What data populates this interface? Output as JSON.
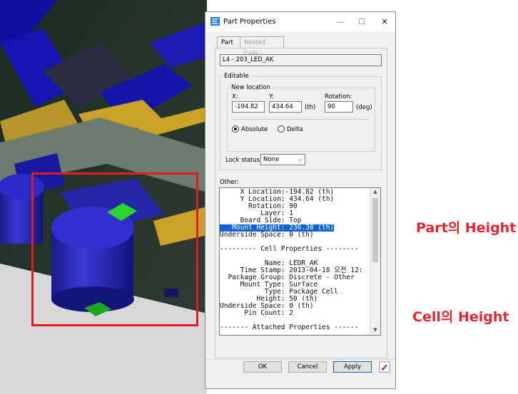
{
  "annotations": {
    "part_height_label": "Part의 Height",
    "cell_height_label": "Cell의 Height"
  },
  "dialog": {
    "title": "Part Properties",
    "title_icon": "app-icon",
    "controls": {
      "minimize": "—",
      "maximize": "☐",
      "close": "✕"
    },
    "tabs": [
      {
        "label": "Part",
        "active": true
      },
      {
        "label": "Nested Cells",
        "active": false
      }
    ],
    "part_name": "L4 - 203_LED_AK",
    "editable": {
      "group_label": "Editable",
      "new_location": {
        "group_label": "New location",
        "x_label": "X:",
        "x_value": "-194.82",
        "y_label": "Y:",
        "y_value": "434.64",
        "unit_th": "(th)",
        "rotation_label": "Rotation:",
        "rotation_value": "90",
        "unit_deg": "(deg)",
        "absolute_label": "Absolute",
        "delta_label": "Delta",
        "selected_mode": "Absolute"
      },
      "lock_status_label": "Lock status:",
      "lock_status_value": "None"
    },
    "other": {
      "label": "Other:",
      "lines": [
        "     X Location:-194.82 (th)",
        "     Y Location: 434.64 (th)",
        "       Rotation: 90",
        "          Layer: 1",
        "     Board Side: Top",
        "   Mount Height: 236.38 (th)",
        "Underside Space: 0 (th)",
        "",
        "--------- Cell Properties --------",
        "",
        "           Name: LEDR_AK",
        "     Time Stamp: 2013-04-18 오전 12:",
        "  Package Group: Discrete - Other",
        "     Mount Type: Surface",
        "           Type: Package Cell",
        "         Height: 50 (th)",
        "Underside Space: 0 (th)",
        "      Pin Count: 2",
        "",
        "------- Attached Properties ------"
      ],
      "selected_line": 5
    },
    "buttons": {
      "ok": "OK",
      "cancel": "Cancel",
      "apply": "Apply"
    },
    "extra_button_icon": "pen-icon"
  },
  "colors": {
    "annotation_red": "#e01b22",
    "selection_blue": "#0a64d2",
    "component_blue": "#1a1aa8"
  }
}
